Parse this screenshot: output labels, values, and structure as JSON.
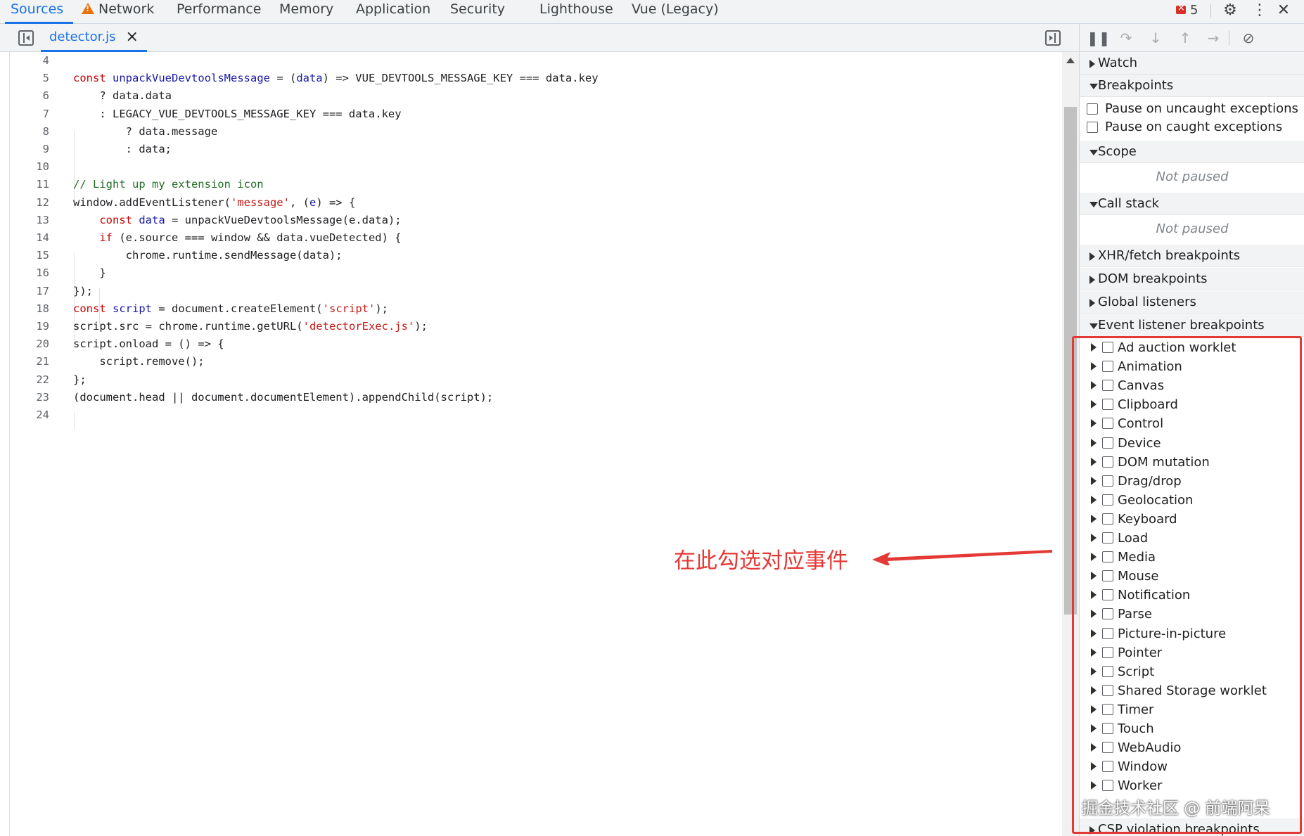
{
  "top_tabs": [
    {
      "label": "Sources",
      "active": true
    },
    {
      "label": "Network",
      "icon": "warning-icon"
    },
    {
      "label": "Performance"
    },
    {
      "label": "Memory"
    },
    {
      "label": "Application"
    },
    {
      "label": "Security"
    },
    {
      "label": "Lighthouse"
    },
    {
      "label": "Vue (Legacy)"
    }
  ],
  "error_count": "5",
  "editor": {
    "file_tab": "detector.js",
    "lines": [
      {
        "n": "4",
        "html": ""
      },
      {
        "n": "5",
        "html": "<span class=\"k\">const</span> <span class=\"f\">unpackVueDevtoolsMessage</span> = (<span class=\"f\">data</span>) => VUE_DEVTOOLS_MESSAGE_KEY === data.key"
      },
      {
        "n": "6",
        "html": "    ? data.data"
      },
      {
        "n": "7",
        "html": "    : LEGACY_VUE_DEVTOOLS_MESSAGE_KEY === data.key"
      },
      {
        "n": "8",
        "html": "        ? data.message"
      },
      {
        "n": "9",
        "html": "        : data;"
      },
      {
        "n": "10",
        "html": ""
      },
      {
        "n": "11",
        "html": "<span class=\"c\">// Light up my extension icon</span>"
      },
      {
        "n": "12",
        "html": "window.addEventListener(<span class=\"s\">'message'</span>, (<span class=\"f\">e</span>) => {"
      },
      {
        "n": "13",
        "html": "    <span class=\"k\">const</span> <span class=\"f\">data</span> = unpackVueDevtoolsMessage(e.data);"
      },
      {
        "n": "14",
        "html": "    <span class=\"k\">if</span> (e.source === window &amp;&amp; data.vueDetected) {"
      },
      {
        "n": "15",
        "html": "        chrome.runtime.sendMessage(data);"
      },
      {
        "n": "16",
        "html": "    }"
      },
      {
        "n": "17",
        "html": "});"
      },
      {
        "n": "18",
        "html": "<span class=\"k\">const</span> <span class=\"f\">script</span> = document.createElement(<span class=\"s\">'script'</span>);"
      },
      {
        "n": "19",
        "html": "script.src = chrome.runtime.getURL(<span class=\"s\">'detectorExec.js'</span>);"
      },
      {
        "n": "20",
        "html": "script.onload = () => {"
      },
      {
        "n": "21",
        "html": "    script.remove();"
      },
      {
        "n": "22",
        "html": "};"
      },
      {
        "n": "23",
        "html": "(document.head || document.documentElement).appendChild(script);"
      },
      {
        "n": "24",
        "html": ""
      }
    ]
  },
  "annotation": "在此勾选对应事件",
  "sidebar": {
    "watch": "Watch",
    "breakpoints": "Breakpoints",
    "pause_uncaught": "Pause on uncaught exceptions",
    "pause_caught": "Pause on caught exceptions",
    "scope": "Scope",
    "scope_status": "Not paused",
    "call_stack": "Call stack",
    "call_stack_status": "Not paused",
    "xhr": "XHR/fetch breakpoints",
    "dom": "DOM breakpoints",
    "global": "Global listeners",
    "event_listener": "Event listener breakpoints",
    "events": [
      "Ad auction worklet",
      "Animation",
      "Canvas",
      "Clipboard",
      "Control",
      "Device",
      "DOM mutation",
      "Drag/drop",
      "Geolocation",
      "Keyboard",
      "Load",
      "Media",
      "Mouse",
      "Notification",
      "Parse",
      "Picture-in-picture",
      "Pointer",
      "Script",
      "Shared Storage worklet",
      "Timer",
      "Touch",
      "WebAudio",
      "Window",
      "Worker"
    ],
    "csp": "CSP violation breakpoints"
  },
  "watermark": "掘金技术社区 @ 前端阿呆"
}
